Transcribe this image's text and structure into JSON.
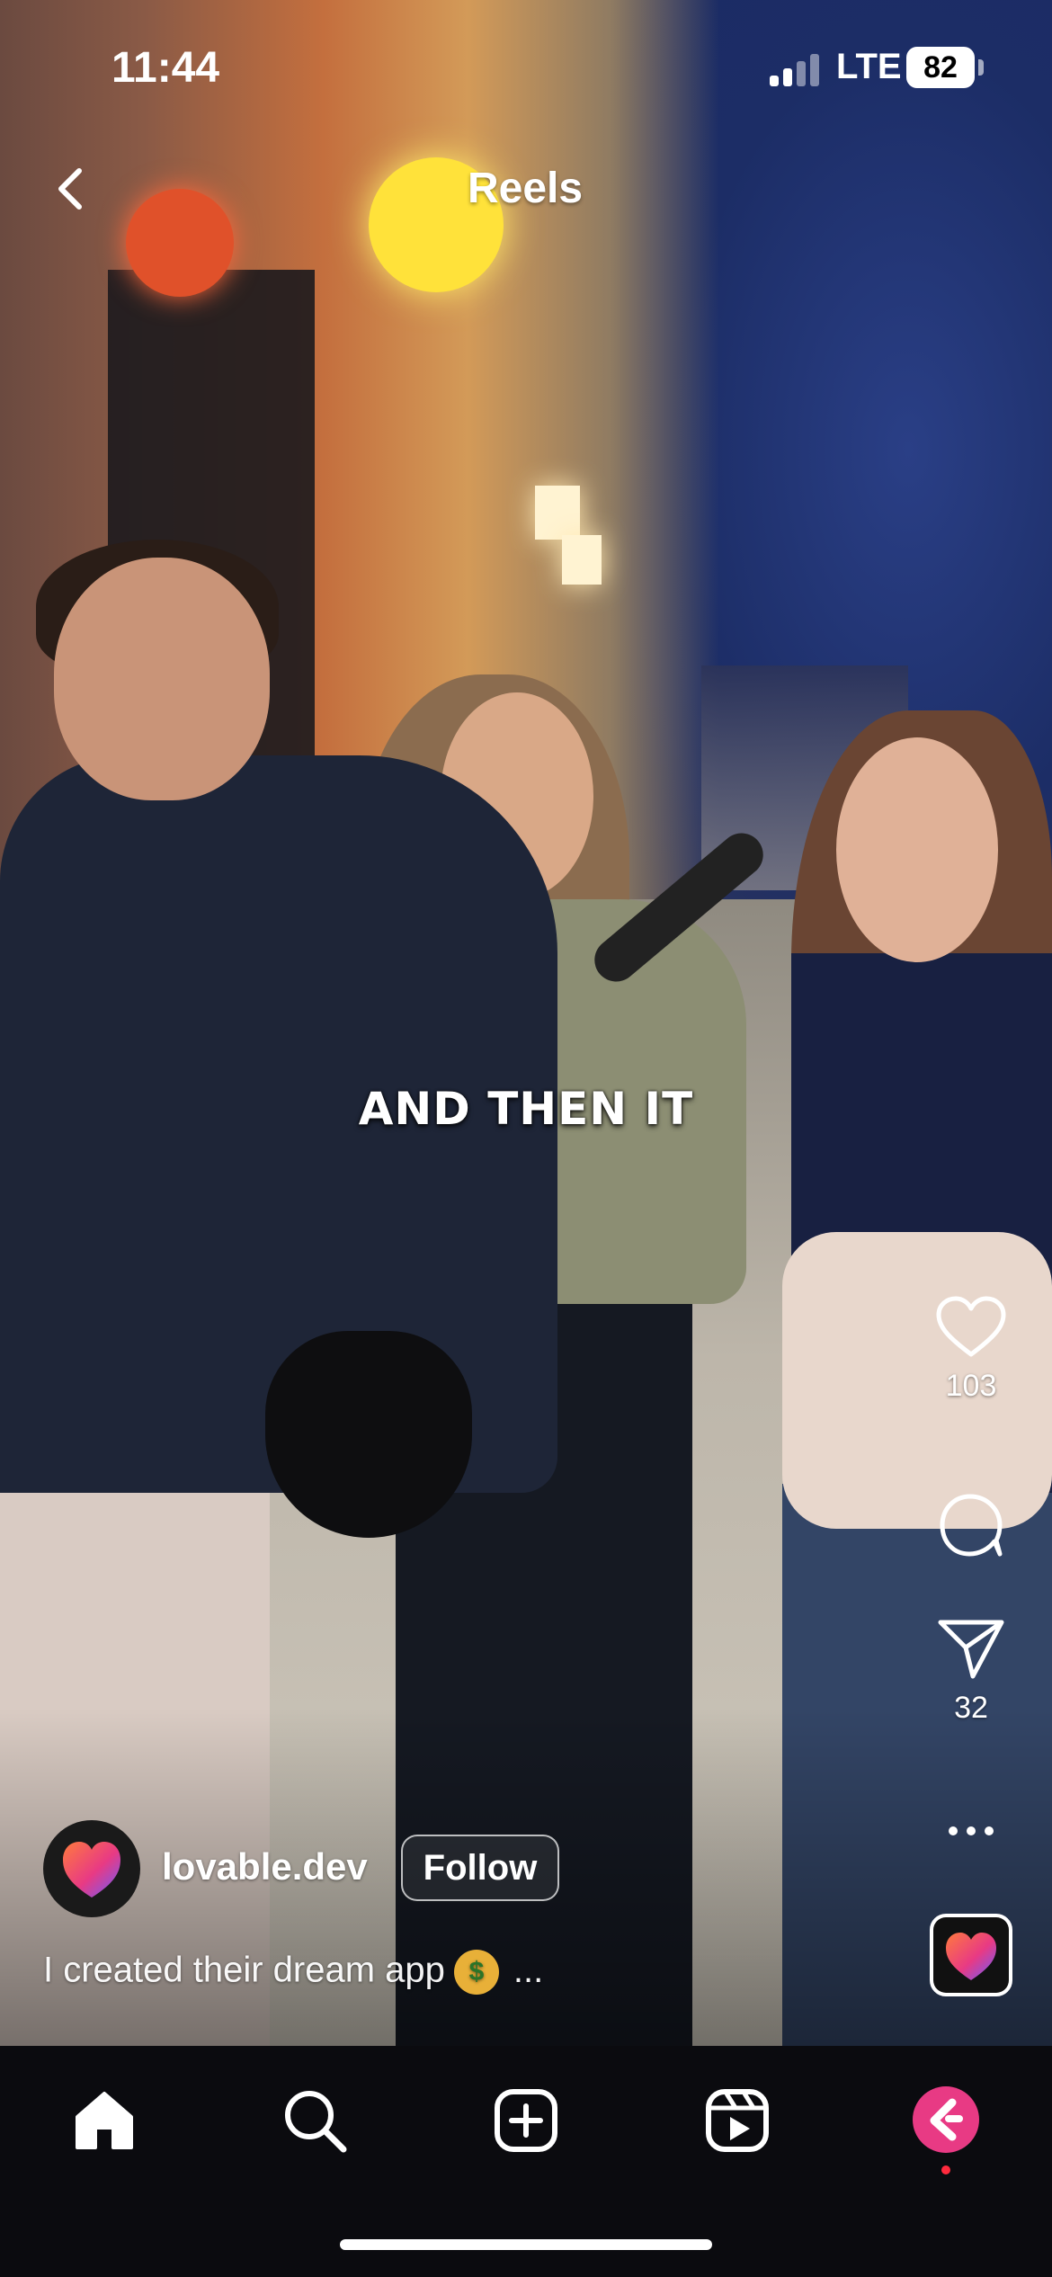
{
  "status_bar": {
    "time": "11:44",
    "network": "LTE",
    "battery": "82"
  },
  "header": {
    "back_icon": "chevron-left-icon",
    "title": "Reels"
  },
  "video": {
    "caption_overlay": "AND THEN IT"
  },
  "actions": {
    "like": {
      "icon": "heart-icon",
      "count": "103"
    },
    "comment": {
      "icon": "comment-icon"
    },
    "share": {
      "icon": "paper-plane-icon",
      "count": "32"
    },
    "more": {
      "icon": "more-dots-icon"
    }
  },
  "author": {
    "username": "lovable.dev",
    "follow_label": "Follow"
  },
  "description": {
    "text": "I created their dream app",
    "emoji": "money-mouth-face-emoji",
    "more": "..."
  },
  "bottom_nav": [
    {
      "name": "home",
      "icon": "home-icon"
    },
    {
      "name": "search",
      "icon": "search-icon"
    },
    {
      "name": "create",
      "icon": "plus-square-icon"
    },
    {
      "name": "reels",
      "icon": "reels-icon"
    },
    {
      "name": "profile",
      "icon": "profile-avatar-icon"
    }
  ],
  "colors": {
    "navbar_bg": "#0b0b0f",
    "brand_gradient": [
      "#ff7a3d",
      "#e83a84",
      "#6a5cff"
    ],
    "profile_accent": "#e83a84",
    "notification_dot": "#ff2a3d"
  }
}
